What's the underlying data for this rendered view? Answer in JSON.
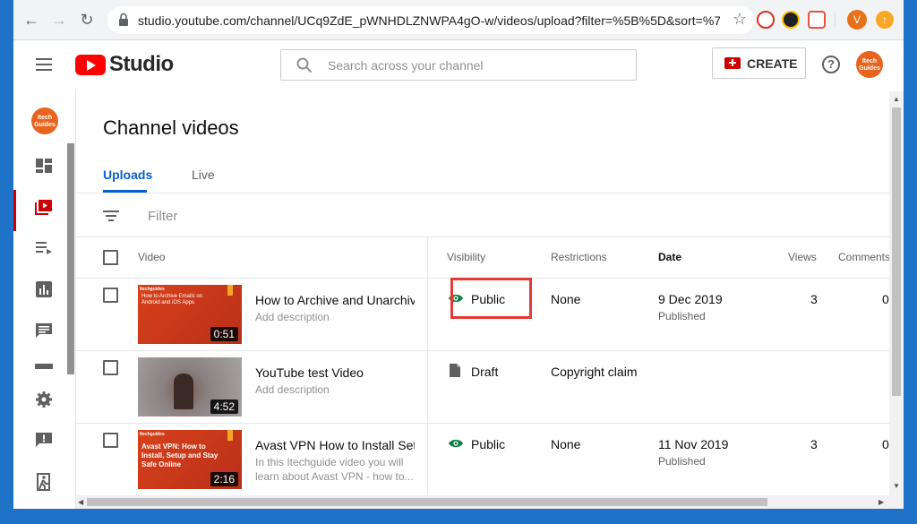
{
  "browser": {
    "url": "studio.youtube.com/channel/UCq9ZdE_pWNHDLZNWPA4gO-w/videos/upload?filter=%5B%5D&sort=%7...",
    "profile_initial": "V"
  },
  "header": {
    "logo_text": "Studio",
    "search_placeholder": "Search across your channel",
    "create_label": "CREATE",
    "help_label": "?",
    "avatar_text": "Itech Guides"
  },
  "sidebar": {
    "avatar_text": "Itech Guides"
  },
  "main": {
    "title": "Channel videos",
    "tabs": [
      {
        "label": "Uploads",
        "active": true
      },
      {
        "label": "Live",
        "active": false
      }
    ],
    "filter_label": "Filter",
    "columns": [
      "Video",
      "Visibility",
      "Restrictions",
      "Date",
      "Views",
      "Comments"
    ]
  },
  "videos": [
    {
      "title": "How to Archive and Unarchiv...",
      "description": "Add description",
      "duration": "0:51",
      "thumb_brand": "Itechguides",
      "thumb_text": "How to Archive Emails on Android and iOS Apps",
      "visibility": "Public",
      "restrictions": "None",
      "date": "9 Dec 2019",
      "date_status": "Published",
      "views": "3",
      "comments": "0"
    },
    {
      "title": "YouTube test Video",
      "description": "Add description",
      "duration": "4:52",
      "visibility": "Draft",
      "restrictions": "Copyright claim"
    },
    {
      "title": "Avast VPN How to Install Set...",
      "description": "In this Itechguide video you will learn about Avast VPN - how to...",
      "duration": "2:16",
      "thumb_brand": "Itechguides",
      "thumb_text": "Avast VPN: How to Install, Setup and Stay Safe Online",
      "visibility": "Public",
      "restrictions": "None",
      "date": "11 Nov 2019",
      "date_status": "Published",
      "views": "3",
      "comments": "0"
    }
  ],
  "colors": {
    "accent_blue": "#065fd4",
    "brand_red": "#ff0000",
    "public_green": "#0b8043",
    "highlight_red": "#e53935",
    "avatar_orange": "#e8631e"
  }
}
